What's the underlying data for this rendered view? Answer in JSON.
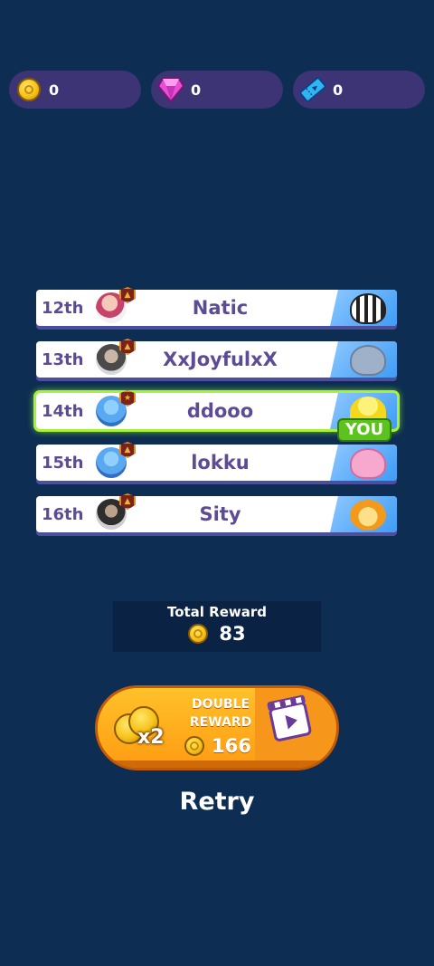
{
  "currencies": [
    {
      "icon": "coin-icon",
      "value": "0"
    },
    {
      "icon": "gem-icon",
      "value": "0"
    },
    {
      "icon": "ticket-icon",
      "value": "0"
    }
  ],
  "leaderboard": [
    {
      "rank": "12th",
      "name": "Natic",
      "pet": "zebra",
      "you": false
    },
    {
      "rank": "13th",
      "name": "XxJoyfulxX",
      "pet": "mouse",
      "you": false
    },
    {
      "rank": "14th",
      "name": "ddooo",
      "pet": "yellow-character",
      "you": true
    },
    {
      "rank": "15th",
      "name": "lokku",
      "pet": "pink-unicorn",
      "you": false
    },
    {
      "rank": "16th",
      "name": "Sity",
      "pet": "lion",
      "you": false
    }
  ],
  "you_label": "YOU",
  "total_reward": {
    "label": "Total Reward",
    "value": "83"
  },
  "double_reward": {
    "line1": "DOUBLE",
    "line2": "REWARD",
    "multiplier": "x2",
    "value": "166"
  },
  "retry_label": "Retry",
  "colors": {
    "background": "#0d2d52",
    "currency_pill": "#3c3474",
    "row_text": "#5d4c95",
    "highlight": "#a6f23a",
    "button_orange": "#f4940e"
  }
}
